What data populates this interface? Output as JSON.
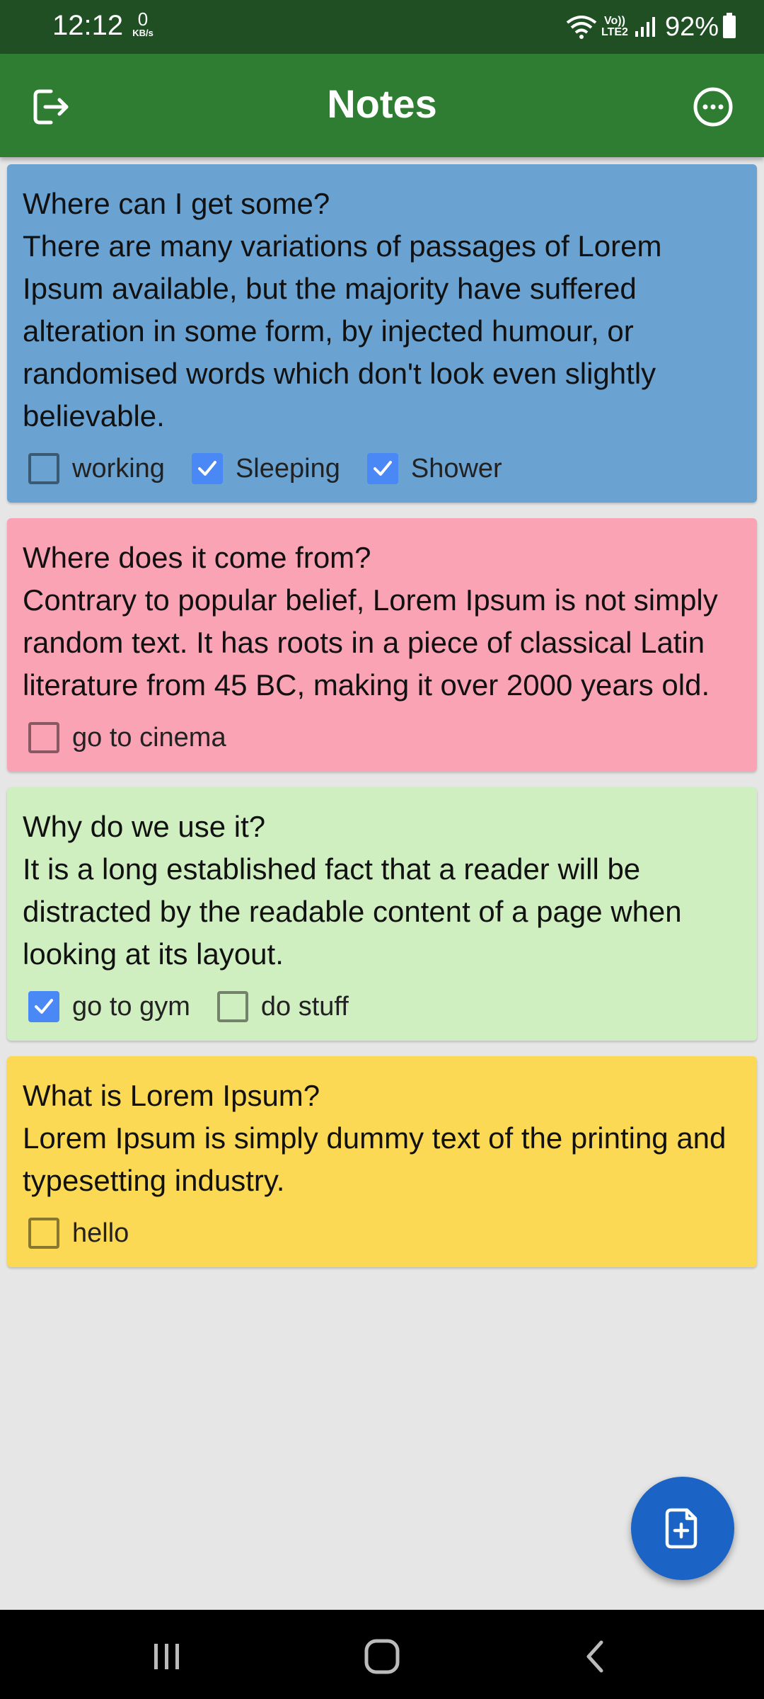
{
  "status_bar": {
    "time": "12:12",
    "net_speed_value": "0",
    "net_speed_unit": "KB/s",
    "network_label": "Vo))\nLTE2",
    "battery": "92%"
  },
  "app_bar": {
    "title": "Notes",
    "left_icon": "logout-icon",
    "right_icon": "more-options-icon"
  },
  "notes": [
    {
      "title": "Where can I get some?",
      "body": "There are many variations of passages of Lorem Ipsum available, but the majority have suffered alteration in some form, by injected humour, or randomised words which don't look even slightly believable.",
      "color": "#6aa2d2",
      "checks": [
        {
          "label": "working",
          "checked": false
        },
        {
          "label": "Sleeping",
          "checked": true
        },
        {
          "label": "Shower",
          "checked": true
        }
      ]
    },
    {
      "title": "Where does it come from?",
      "body": "Contrary to popular belief, Lorem Ipsum is not simply random text. It has roots in a piece of classical Latin literature from 45 BC, making it over 2000 years old.",
      "color": "#f9a3b5",
      "checks": [
        {
          "label": "go to cinema",
          "checked": false
        }
      ]
    },
    {
      "title": "Why do we use it?",
      "body": "It is a long established fact that a reader will be distracted by the readable content of a page when looking at its layout.",
      "color": "#d0efc0",
      "checks": [
        {
          "label": "go to gym",
          "checked": true
        },
        {
          "label": "do stuff",
          "checked": false
        }
      ]
    },
    {
      "title": "What is Lorem Ipsum?",
      "body": "Lorem Ipsum is simply dummy text of the printing and typesetting industry.",
      "color": "#fcd955",
      "checks": [
        {
          "label": "hello",
          "checked": false
        }
      ]
    }
  ],
  "fab": {
    "icon": "add-note-icon"
  },
  "nav_bar": {
    "icons": [
      "recent-apps-icon",
      "home-icon",
      "back-icon"
    ]
  }
}
